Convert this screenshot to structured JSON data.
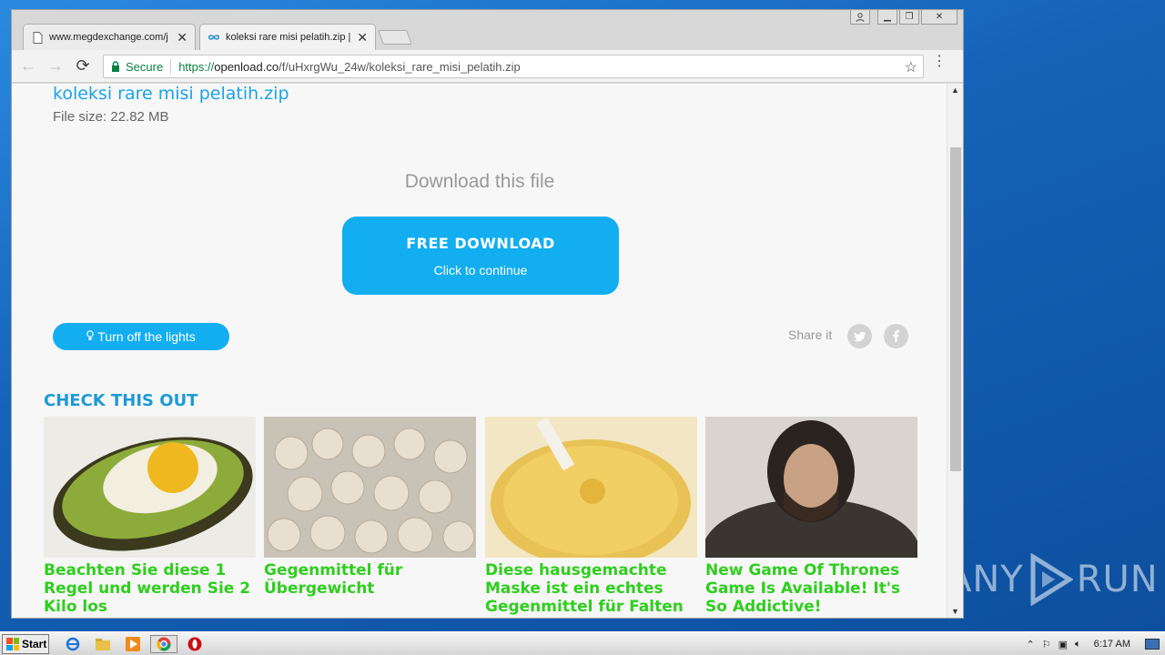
{
  "browser": {
    "tabs": [
      {
        "title": "www.megdexchange.com/j",
        "icon": "page-icon"
      },
      {
        "title": "koleksi rare misi pelatih.zip |",
        "icon": "openload-icon"
      }
    ],
    "address": {
      "secure_label": "Secure",
      "url_scheme": "https://",
      "url_host": "openload.co",
      "url_path": "/f/uHxrgWu_24w/koleksi_rare_misi_pelatih.zip"
    }
  },
  "page": {
    "file_name": "koleksi rare misi pelatih.zip",
    "file_size": "File size: 22.82 MB",
    "download_heading": "Download this file",
    "download_button": {
      "main": "FREE DOWNLOAD",
      "sub": "Click to continue"
    },
    "lights_button": "Turn off the lights",
    "share_label": "Share it",
    "check_heading": "CHECK THIS OUT",
    "cards": [
      {
        "caption": "Beachten Sie diese 1 Regel und werden Sie 2 Kilo los"
      },
      {
        "caption": "Gegenmittel für Übergewicht"
      },
      {
        "caption": "Diese hausgemachte Maske ist ein echtes Gegenmittel für Falten"
      },
      {
        "caption": "New Game Of Thrones Game Is Available! It's So Addictive!"
      }
    ]
  },
  "taskbar": {
    "start_label": "Start",
    "clock": "6:17 AM"
  },
  "watermark": {
    "left": "ANY",
    "right": "RUN"
  },
  "colors": {
    "accent": "#12aef0",
    "caption_green": "#2fce1e",
    "heading_blue": "#1e9ad6"
  }
}
